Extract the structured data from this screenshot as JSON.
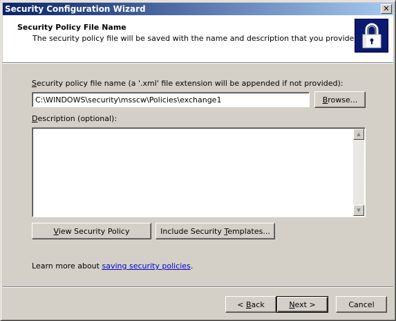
{
  "window": {
    "title": "Security Configuration Wizard",
    "close_glyph": "✕"
  },
  "header": {
    "title": "Security Policy File Name",
    "subtitle": "The security policy file will be saved with the name and description that you provide.",
    "icon": "padlock-icon"
  },
  "file_name": {
    "label_prefix": "",
    "label_accel": "S",
    "label_rest": "ecurity policy file name (a '.xml' file extension will be appended if not provided):",
    "value": "C:\\WINDOWS\\security\\msscw\\Policies\\exchange1",
    "browse_label_prefix": "",
    "browse_accel": "B",
    "browse_label_rest": "rowse..."
  },
  "description": {
    "label_prefix": "",
    "label_accel": "D",
    "label_rest": "escription (optional):",
    "value": "",
    "scroll_up": "▲",
    "scroll_down": "▼"
  },
  "actions": {
    "view_prefix": "",
    "view_accel": "V",
    "view_rest": "iew Security Policy",
    "include_prefix": "Include Security ",
    "include_accel": "T",
    "include_rest": "emplates..."
  },
  "learn_more": {
    "prefix": "Learn more about ",
    "link": "saving security policies",
    "suffix": "."
  },
  "footer": {
    "back_prefix": "< ",
    "back_accel": "B",
    "back_rest": "ack",
    "next_prefix": "",
    "next_accel": "N",
    "next_rest": "ext >",
    "cancel_label": "Cancel"
  },
  "colors": {
    "title_bar_start": "#0a246a",
    "title_bar_end": "#a6caf0",
    "dialog_face": "#d4d0c8",
    "link": "#0000cc"
  }
}
